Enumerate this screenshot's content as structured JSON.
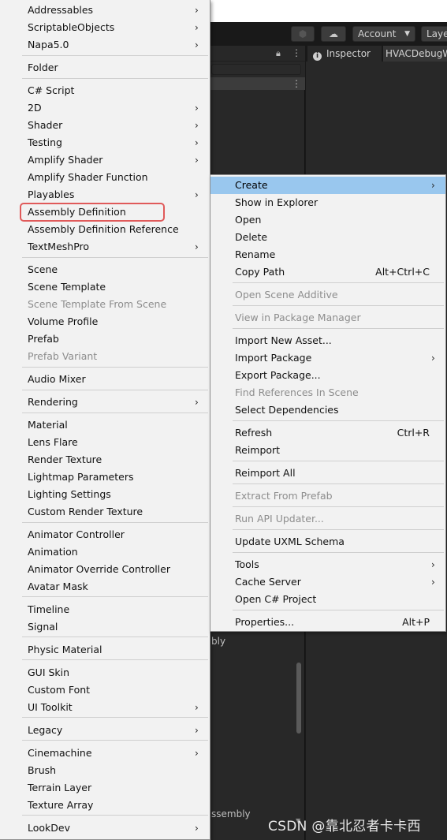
{
  "toolbar": {
    "account_label": "Account",
    "layers_label": "Layers"
  },
  "inspector_tabs": {
    "inspector": "Inspector",
    "hvac": "HVACDebugWindow"
  },
  "project_peek": {
    "text1": "bly",
    "text2": "ssembly"
  },
  "watermark": "CSDN @靠北忍者卡卡西",
  "create_menu": {
    "items": [
      {
        "label": "Addressables",
        "submenu": true
      },
      {
        "label": "ScriptableObjects",
        "submenu": true
      },
      {
        "label": "Napa5.0",
        "submenu": true
      },
      {
        "label": "Folder"
      },
      {
        "label": "C# Script"
      },
      {
        "label": "2D",
        "submenu": true
      },
      {
        "label": "Shader",
        "submenu": true
      },
      {
        "label": "Testing",
        "submenu": true
      },
      {
        "label": "Amplify Shader",
        "submenu": true
      },
      {
        "label": "Amplify Shader Function"
      },
      {
        "label": "Playables",
        "submenu": true
      },
      {
        "label": "Assembly Definition",
        "highlighted": true
      },
      {
        "label": "Assembly Definition Reference"
      },
      {
        "label": "TextMeshPro",
        "submenu": true
      },
      {
        "label": "Scene"
      },
      {
        "label": "Scene Template"
      },
      {
        "label": "Scene Template From Scene",
        "disabled": true
      },
      {
        "label": "Volume Profile"
      },
      {
        "label": "Prefab"
      },
      {
        "label": "Prefab Variant",
        "disabled": true
      },
      {
        "label": "Audio Mixer"
      },
      {
        "label": "Rendering",
        "submenu": true
      },
      {
        "label": "Material"
      },
      {
        "label": "Lens Flare"
      },
      {
        "label": "Render Texture"
      },
      {
        "label": "Lightmap Parameters"
      },
      {
        "label": "Lighting Settings"
      },
      {
        "label": "Custom Render Texture"
      },
      {
        "label": "Animator Controller"
      },
      {
        "label": "Animation"
      },
      {
        "label": "Animator Override Controller"
      },
      {
        "label": "Avatar Mask"
      },
      {
        "label": "Timeline"
      },
      {
        "label": "Signal"
      },
      {
        "label": "Physic Material"
      },
      {
        "label": "GUI Skin"
      },
      {
        "label": "Custom Font"
      },
      {
        "label": "UI Toolkit",
        "submenu": true
      },
      {
        "label": "Legacy",
        "submenu": true
      },
      {
        "label": "Cinemachine",
        "submenu": true
      },
      {
        "label": "Brush"
      },
      {
        "label": "Terrain Layer"
      },
      {
        "label": "Texture Array"
      },
      {
        "label": "LookDev",
        "submenu": true
      }
    ]
  },
  "context_menu": {
    "items": [
      {
        "label": "Create",
        "submenu": true,
        "selected": true
      },
      {
        "label": "Show in Explorer"
      },
      {
        "label": "Open"
      },
      {
        "label": "Delete"
      },
      {
        "label": "Rename"
      },
      {
        "label": "Copy Path",
        "shortcut": "Alt+Ctrl+C"
      },
      {
        "label": "Open Scene Additive",
        "disabled": true
      },
      {
        "label": "View in Package Manager",
        "disabled": true
      },
      {
        "label": "Import New Asset..."
      },
      {
        "label": "Import Package",
        "submenu": true
      },
      {
        "label": "Export Package..."
      },
      {
        "label": "Find References In Scene",
        "disabled": true
      },
      {
        "label": "Select Dependencies"
      },
      {
        "label": "Refresh",
        "shortcut": "Ctrl+R"
      },
      {
        "label": "Reimport"
      },
      {
        "label": "Reimport All"
      },
      {
        "label": "Extract From Prefab",
        "disabled": true
      },
      {
        "label": "Run API Updater...",
        "disabled": true
      },
      {
        "label": "Update UXML Schema"
      },
      {
        "label": "Tools",
        "submenu": true
      },
      {
        "label": "Cache Server",
        "submenu": true
      },
      {
        "label": "Open C# Project"
      },
      {
        "label": "Properties...",
        "shortcut": "Alt+P"
      }
    ]
  }
}
